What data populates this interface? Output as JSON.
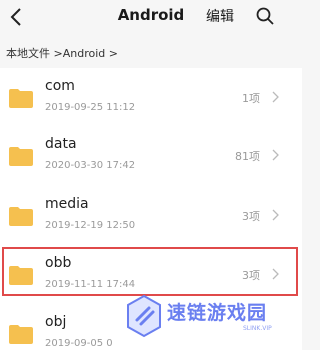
{
  "header": {
    "title": "Android",
    "edit_label": "编辑",
    "back_icon": "chevron-left-icon",
    "search_icon": "search-icon"
  },
  "breadcrumb": {
    "text": "本地文件 >Android >"
  },
  "folders": [
    {
      "name": "com",
      "date": "2019-09-25 11:12",
      "count": "1项"
    },
    {
      "name": "data",
      "date": "2020-03-30 17:42",
      "count": "81项"
    },
    {
      "name": "media",
      "date": "2019-12-19 12:50",
      "count": "3项"
    },
    {
      "name": "obb",
      "date": "2019-11-11 17:44",
      "count": "3项"
    },
    {
      "name": "obj",
      "date": "2019-09-05 0",
      "count": ""
    }
  ],
  "watermark": {
    "text": "速链游戏园",
    "sub": "SLINK.VIP"
  },
  "colors": {
    "folder": "#f5c04f",
    "highlight": "#e04a4a",
    "watermark": "#6a7ff0"
  }
}
